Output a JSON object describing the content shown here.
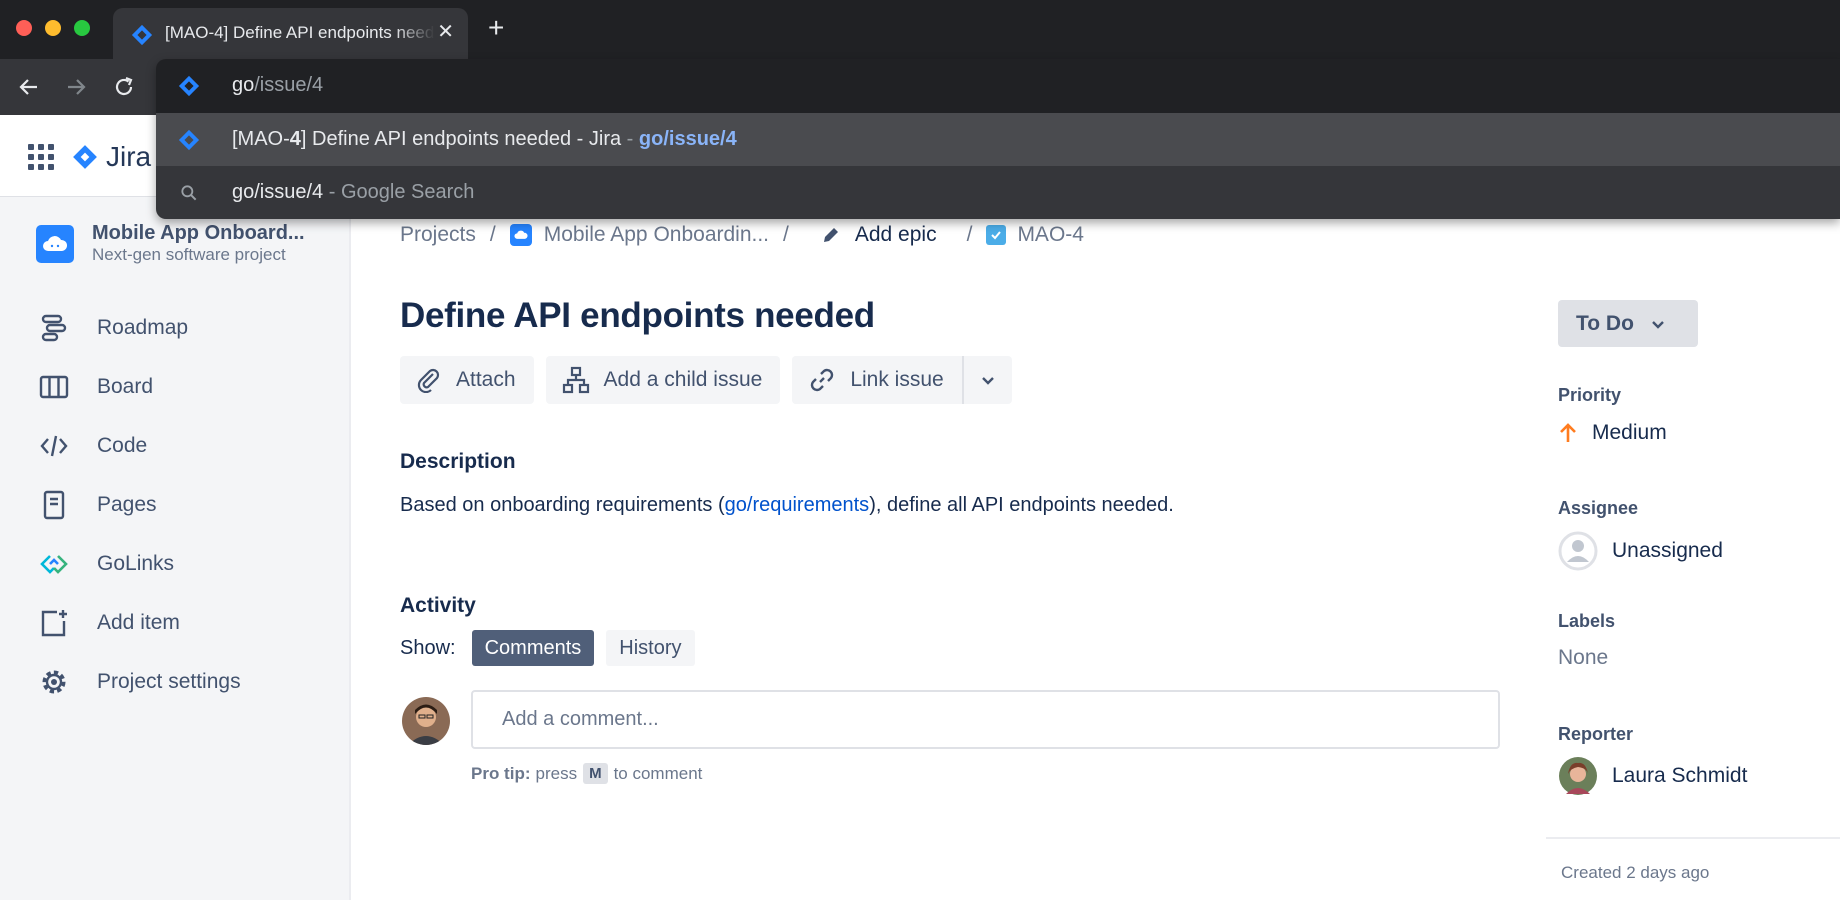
{
  "colors": {
    "jira_blue": "#2684ff",
    "link_blue": "#0052cc",
    "priority_orange": "#ff7c1f",
    "chrome_dark": "#202124",
    "chrome_tab": "#35363a"
  },
  "browser": {
    "tab_title": "[MAO-4] Define API endpoints needed - Jira",
    "address_typed": "go",
    "address_completion": "/issue/4",
    "suggestions": [
      {
        "icon": "jira-icon",
        "prefix": "[MAO-",
        "bold": "4",
        "title_rest": "] Define API endpoints needed - Jira",
        "separator": " - ",
        "url": "go/issue/4"
      },
      {
        "icon": "search-icon",
        "query": "go/issue/4",
        "suffix": " - Google Search"
      }
    ]
  },
  "jira": {
    "product_name": "Jira"
  },
  "project": {
    "name": "Mobile App Onboard...",
    "type": "Next-gen software project"
  },
  "sidebar": {
    "items": [
      {
        "label": "Roadmap",
        "icon": "roadmap-icon"
      },
      {
        "label": "Board",
        "icon": "board-icon"
      },
      {
        "label": "Code",
        "icon": "code-icon"
      },
      {
        "label": "Pages",
        "icon": "pages-icon"
      },
      {
        "label": "GoLinks",
        "icon": "golinks-icon"
      },
      {
        "label": "Add item",
        "icon": "add-item-icon"
      },
      {
        "label": "Project settings",
        "icon": "gear-icon"
      }
    ]
  },
  "breadcrumbs": {
    "projects": "Projects",
    "project": "Mobile App Onboardin...",
    "epic": "Add epic",
    "issue_key": "MAO-4",
    "separator": "/"
  },
  "issue": {
    "title": "Define API endpoints needed",
    "actions": {
      "attach": "Attach",
      "child": "Add a child issue",
      "link": "Link issue"
    },
    "description_heading": "Description",
    "description_before": "Based on onboarding requirements (",
    "description_link": "go/requirements",
    "description_after": "), define all API endpoints needed."
  },
  "activity": {
    "heading": "Activity",
    "show_label": "Show:",
    "tabs": {
      "comments": "Comments",
      "history": "History"
    },
    "comment_placeholder": "Add a comment...",
    "protip_label": "Pro tip:",
    "protip_press": "press",
    "protip_key": "M",
    "protip_after": "to comment"
  },
  "details": {
    "status": "To Do",
    "priority_label": "Priority",
    "priority_value": "Medium",
    "assignee_label": "Assignee",
    "assignee_value": "Unassigned",
    "labels_label": "Labels",
    "labels_value": "None",
    "reporter_label": "Reporter",
    "reporter_value": "Laura Schmidt",
    "created": "Created 2 days ago"
  }
}
